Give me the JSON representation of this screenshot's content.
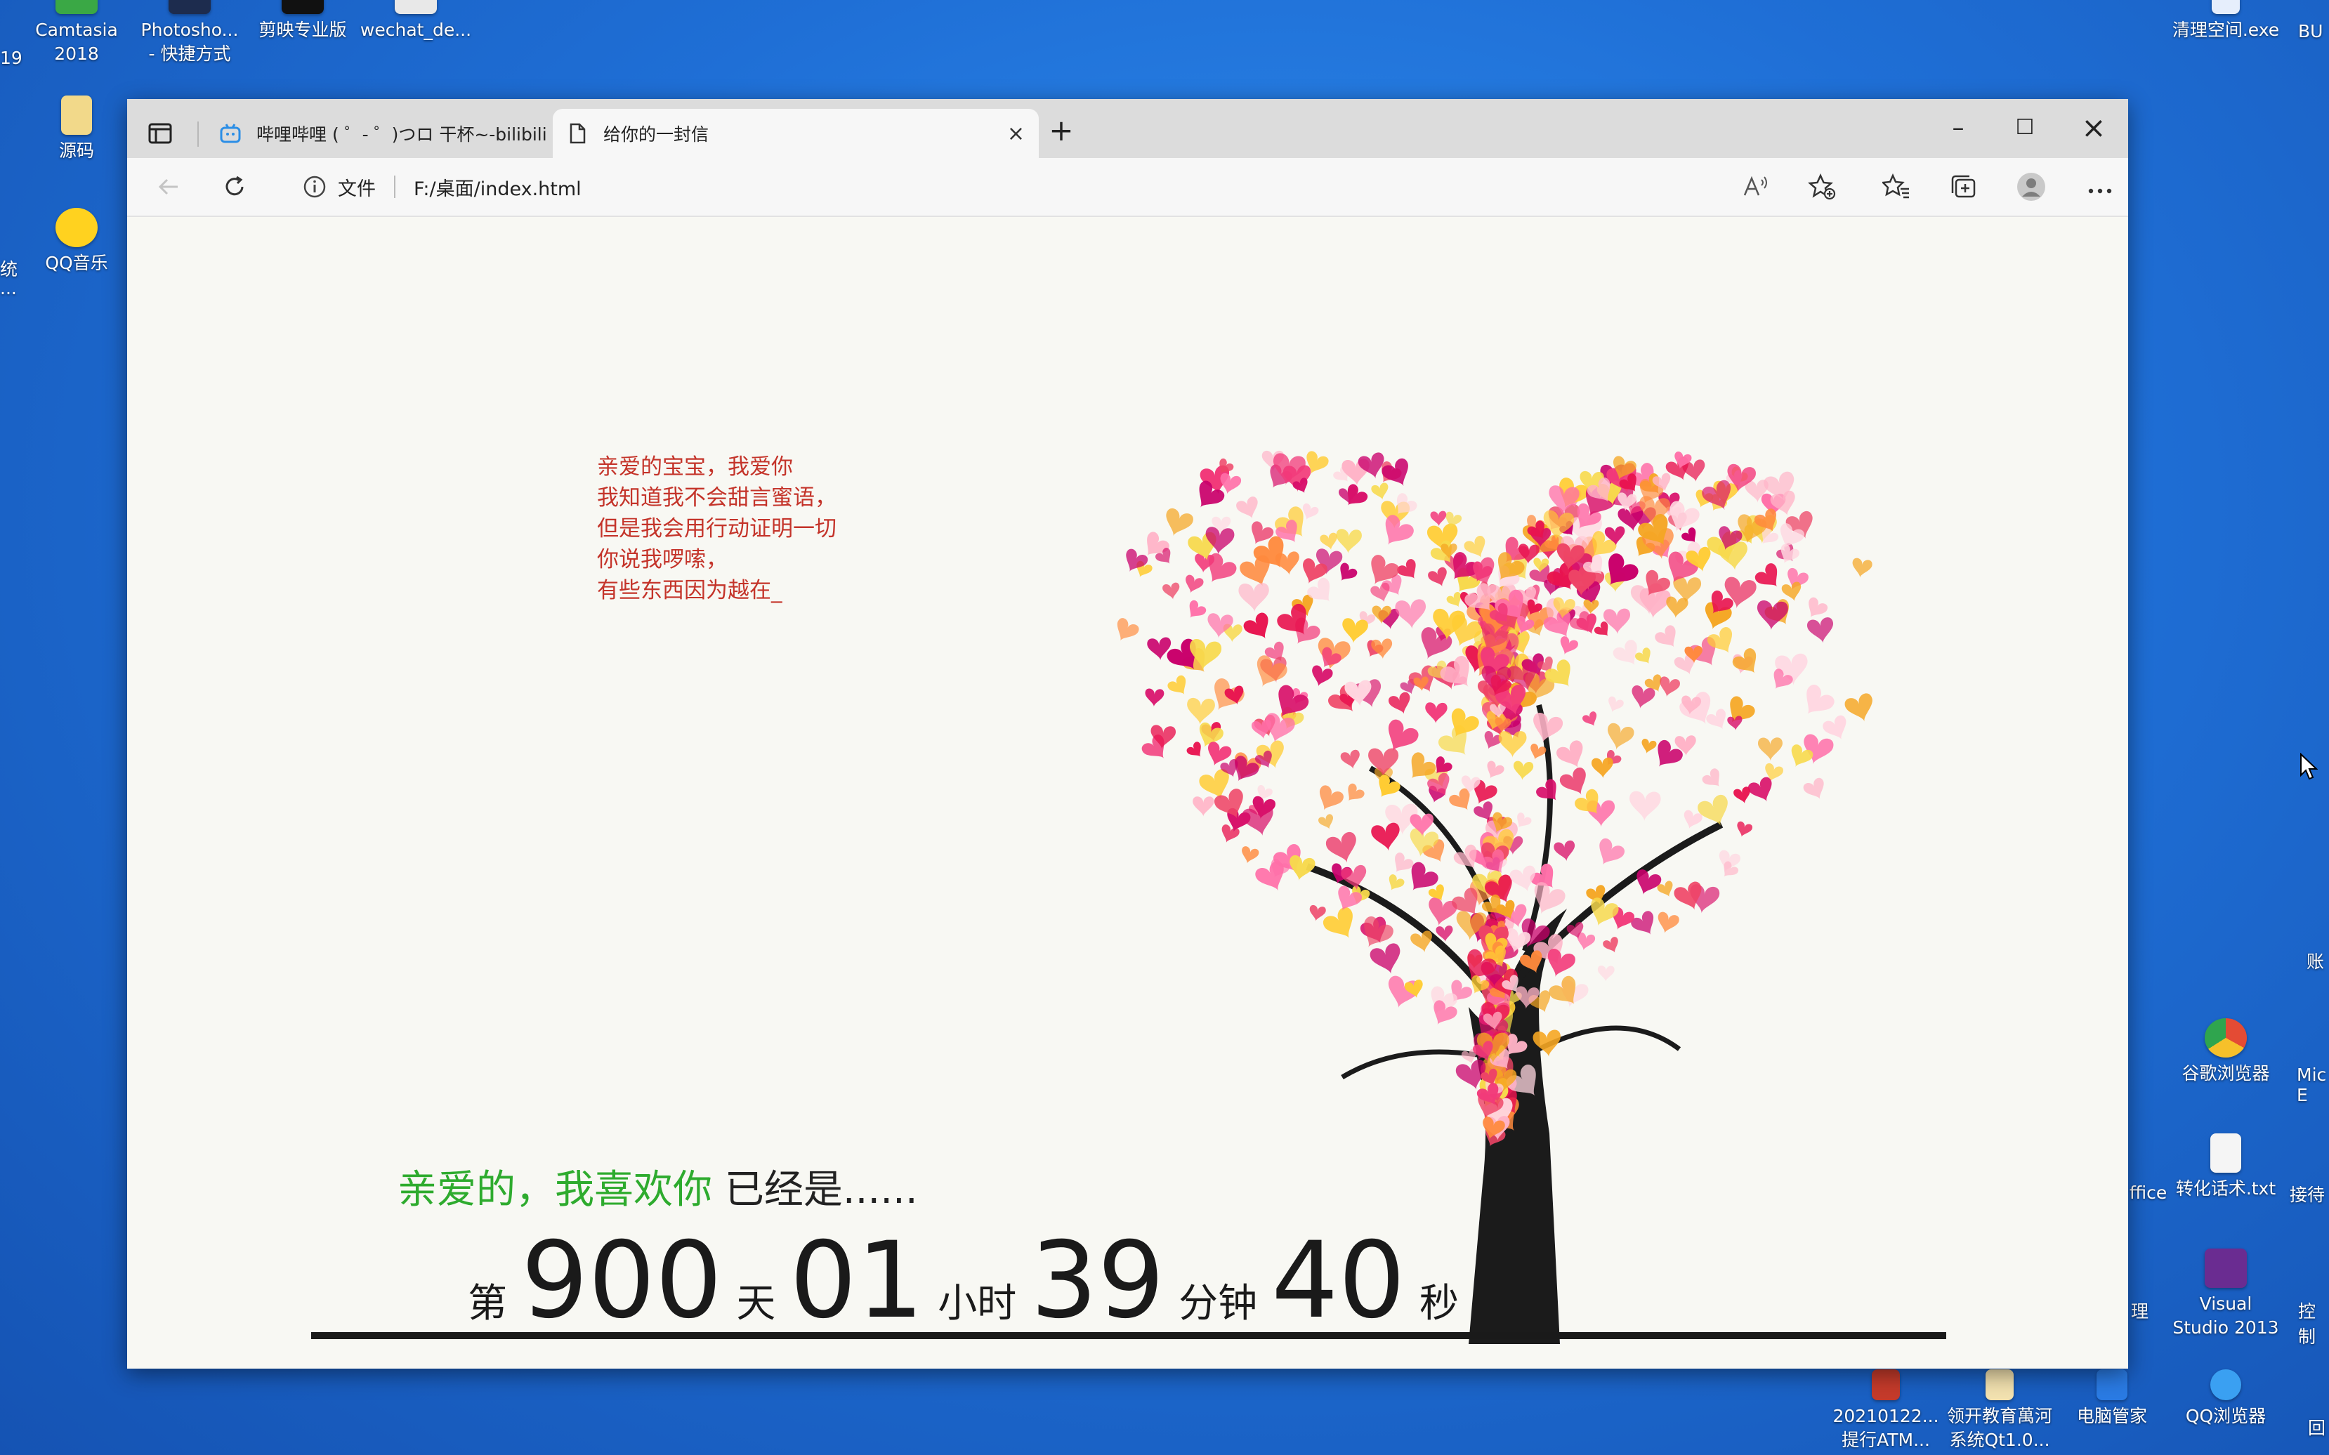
{
  "desktop": {
    "icons_top": [
      {
        "label": "Camtasia\n2018",
        "color": "#3aa845"
      },
      {
        "label": "Photosho...\n- 快捷方式",
        "color": "#1d2c4e"
      },
      {
        "label": "剪映专业版",
        "color": "#111111"
      },
      {
        "label": "wechat_de...",
        "color": "#e8e8e8"
      }
    ],
    "edge_left": [
      "19",
      "统",
      "..."
    ],
    "icon_source": {
      "label": "源码",
      "color": "#f2d98a"
    },
    "icon_qqmusic": {
      "label": "QQ音乐",
      "color": "#ffd21f"
    },
    "top_right": {
      "label": "清理空间.exe",
      "label2": "BU"
    },
    "right_icons": [
      {
        "label": "谷歌浏览器",
        "color": "#e44b34"
      },
      {
        "label": "转化话术.txt",
        "color": "#f5f5f5"
      },
      {
        "label": "Visual\nStudio 2013",
        "color": "#6a2c91"
      }
    ],
    "right_edge": [
      "Mic\nE",
      "接待",
      "控制",
      "账",
      "ffice",
      "理"
    ],
    "bottom_icons": [
      {
        "label": "20210122...\n提行ATM...",
        "color": "#c63b2b"
      },
      {
        "label": "领开教育萬河\n系统Qt1.0...",
        "color": "#f3e2b0"
      },
      {
        "label": "电脑管家",
        "color": "#2a7be4"
      },
      {
        "label": "QQ浏览器",
        "color": "#3aa0f2"
      },
      {
        "label": "回",
        "color": "#1b66c9"
      }
    ]
  },
  "browser": {
    "tabs": [
      {
        "title": "哔哩哔哩 ( ゜- ゜)つロ 干杯~-bilibili",
        "close": "×"
      },
      {
        "title": "给你的一封信",
        "close": "×"
      }
    ],
    "new_tab": "+",
    "controls": {
      "minimize": "–",
      "maximize": "☐",
      "close": "×"
    },
    "address": {
      "info_label": "文件",
      "url": "F:/桌面/index.html"
    }
  },
  "page": {
    "letter_lines": [
      "亲爱的宝宝，我爱你",
      "我知道我不会甜言蜜语，",
      "但是我会用行动证明一切",
      "你说我啰嗦，",
      "有些东西因为越在_"
    ],
    "love_green": "亲爱的，我喜欢你",
    "love_dark": "已经是......",
    "counter": {
      "prefix": "第",
      "days": "900",
      "days_unit": "天",
      "hours": "01",
      "hours_unit": "小时",
      "minutes": "39",
      "minutes_unit": "分钟",
      "seconds": "40",
      "seconds_unit": "秒"
    }
  }
}
